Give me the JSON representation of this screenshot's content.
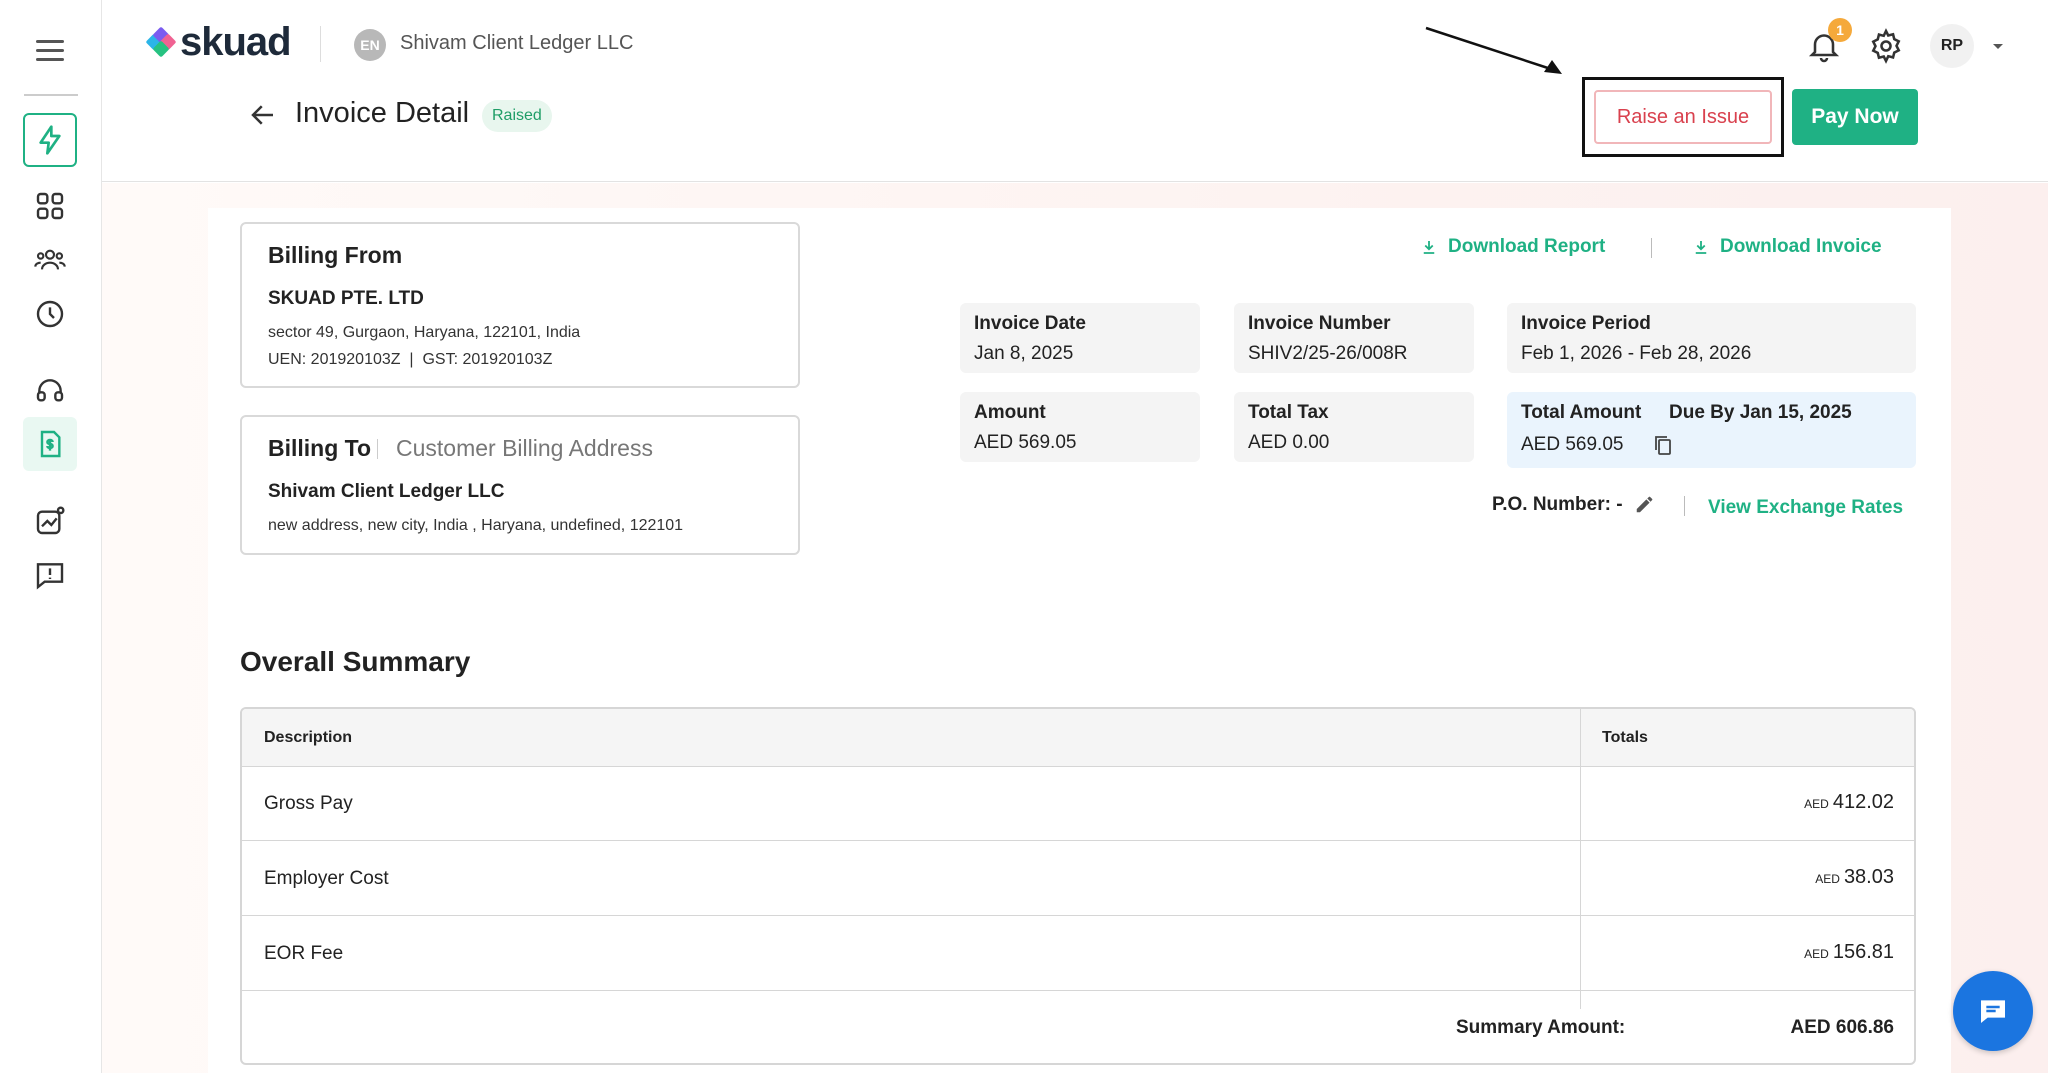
{
  "header": {
    "logo_text": "skuad",
    "client_initials": "EN",
    "client_name": "Shivam Client Ledger LLC",
    "notification_count": "1",
    "user_initials": "RP",
    "page_title": "Invoice Detail",
    "status": "Raised",
    "raise_issue_label": "Raise an Issue",
    "pay_now_label": "Pay Now"
  },
  "sidebar": {
    "items": [
      {
        "name": "bolt-icon"
      },
      {
        "name": "grid-icon"
      },
      {
        "name": "people-icon"
      },
      {
        "name": "clock-icon"
      },
      {
        "name": "support-icon"
      },
      {
        "name": "invoice-icon"
      },
      {
        "name": "analytics-icon"
      },
      {
        "name": "feedback-icon"
      }
    ]
  },
  "billing_from": {
    "title": "Billing From",
    "company": "SKUAD PTE. LTD",
    "address": "sector 49, Gurgaon, Haryana, 122101, India",
    "ids": "UEN: 201920103Z  |  GST: 201920103Z"
  },
  "billing_to": {
    "title": "Billing To",
    "subtitle": "Customer Billing Address",
    "company": "Shivam Client Ledger LLC",
    "address": "new address, new city, India , Haryana, undefined, 122101"
  },
  "downloads": {
    "report": "Download Report",
    "invoice": "Download Invoice"
  },
  "invoice": {
    "date_label": "Invoice Date",
    "date_value": "Jan 8, 2025",
    "number_label": "Invoice Number",
    "number_value": "SHIV2/25-26/008R",
    "period_label": "Invoice Period",
    "period_value": "Feb 1, 2026 - Feb 28, 2026",
    "amount_label": "Amount",
    "amount_value": "AED 569.05",
    "tax_label": "Total Tax",
    "tax_value": "AED 0.00",
    "total_label": "Total Amount",
    "due_label": "Due By Jan 15, 2025",
    "total_value": "AED 569.05",
    "po_label": "P.O. Number: -",
    "exchange_link": "View Exchange Rates"
  },
  "summary": {
    "title": "Overall Summary",
    "col_description": "Description",
    "col_totals": "Totals",
    "currency": "AED",
    "rows": [
      {
        "desc": "Gross Pay",
        "amount": "412.02"
      },
      {
        "desc": "Employer Cost",
        "amount": "38.03"
      },
      {
        "desc": "EOR Fee",
        "amount": "156.81"
      }
    ],
    "total_label": "Summary Amount:",
    "total_value": "AED 606.86"
  },
  "colors": {
    "brand_green": "#1fb184",
    "danger": "#d9414e",
    "chat_blue": "#1b75e0"
  }
}
